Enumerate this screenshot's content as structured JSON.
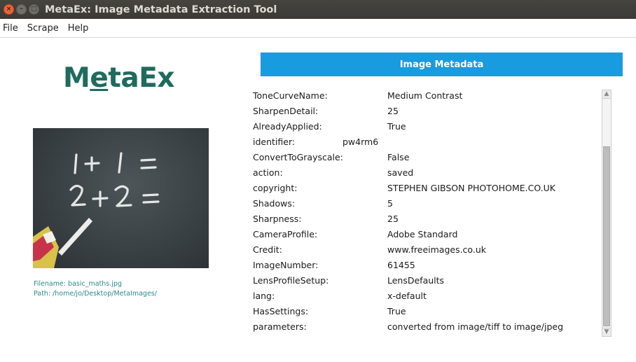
{
  "window": {
    "title": "MetaEx: Image Metadata Extraction Tool",
    "close_glyph": "×",
    "minimize_glyph": "–",
    "maximize_glyph": "□"
  },
  "menu": {
    "items": [
      "File",
      "Scrape",
      "Help"
    ]
  },
  "logo": {
    "part1": "M",
    "part2": "e",
    "part3": "taEx"
  },
  "image": {
    "description_icon": "chalkboard-math-image",
    "chalk_line1": "1+1=",
    "chalk_line2": "2+2="
  },
  "file_info": {
    "filename": "Filename: basic_maths.jpg",
    "path": "Path: /home/jo/Desktop/MetaImages/"
  },
  "metadata": {
    "header": "Image Metadata",
    "rows": [
      {
        "key": "ToneCurveName:",
        "value": "Medium Contrast"
      },
      {
        "key": "SharpenDetail:",
        "value": "25"
      },
      {
        "key": "AlreadyApplied:",
        "value": "True"
      },
      {
        "key": "identifier:",
        "value": "pw4rm6"
      },
      {
        "key": "ConvertToGrayscale:",
        "value": "False"
      },
      {
        "key": "action:",
        "value": "saved"
      },
      {
        "key": "copyright:",
        "value": "STEPHEN GIBSON PHOTOHOME.CO.UK"
      },
      {
        "key": "Shadows:",
        "value": "5"
      },
      {
        "key": "Sharpness:",
        "value": "25"
      },
      {
        "key": "CameraProfile:",
        "value": "Adobe Standard"
      },
      {
        "key": "Credit:",
        "value": "www.freeimages.co.uk"
      },
      {
        "key": "ImageNumber:",
        "value": "61455"
      },
      {
        "key": "LensProfileSetup:",
        "value": "LensDefaults"
      },
      {
        "key": "lang:",
        "value": "x-default"
      },
      {
        "key": "HasSettings:",
        "value": "True"
      },
      {
        "key": "parameters:",
        "value": "converted from image/tiff to image/jpeg"
      }
    ]
  },
  "scrollbar": {
    "up_glyph": "▲",
    "down_glyph": "▼"
  },
  "colors": {
    "header_bg": "#199bdf",
    "logo": "#1f6b5d",
    "file_info": "#2a8b88",
    "close_button": "#e9643a"
  }
}
